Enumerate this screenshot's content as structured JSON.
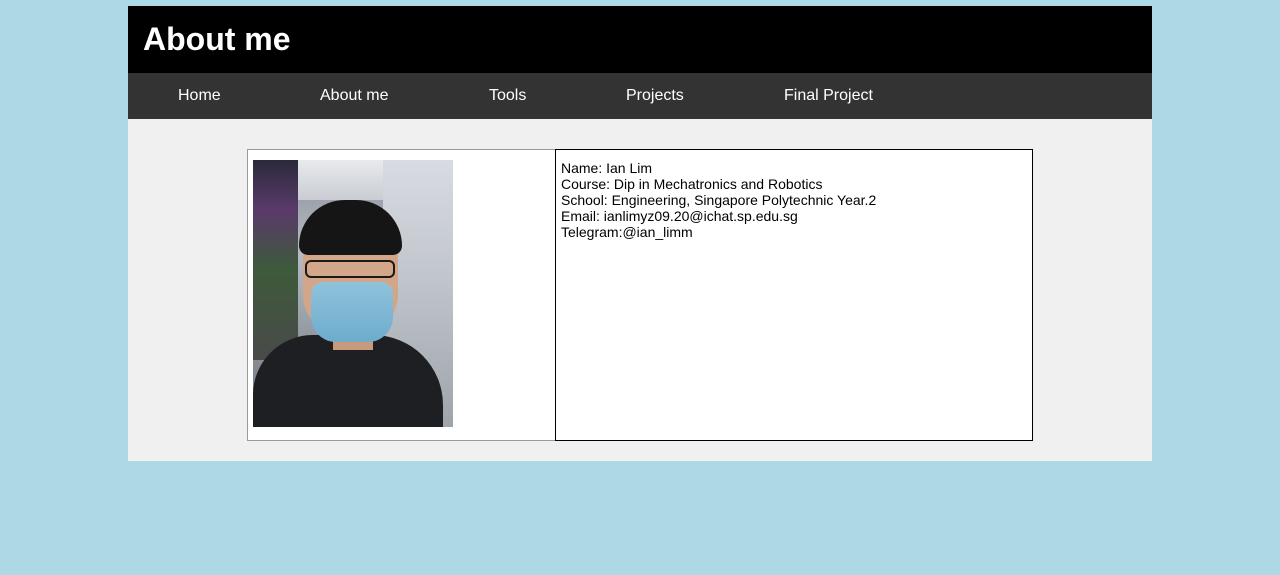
{
  "header": {
    "title": "About me"
  },
  "nav": {
    "items": [
      {
        "label": "Home"
      },
      {
        "label": "About me"
      },
      {
        "label": "Tools"
      },
      {
        "label": "Projects"
      },
      {
        "label": "Final Project"
      }
    ]
  },
  "profile": {
    "photo_alt": "Profile photo",
    "lines": [
      "Name: Ian Lim",
      "Course: Dip in Mechatronics and Robotics",
      "School: Engineering, Singapore Polytechnic Year.2",
      "Email: ianlimyz09.20@ichat.sp.edu.sg",
      "Telegram:@ian_limm"
    ]
  },
  "colors": {
    "page_background": "#add8e6",
    "header_background": "#000000",
    "nav_background": "#333333",
    "content_background": "#f0f0f0"
  }
}
